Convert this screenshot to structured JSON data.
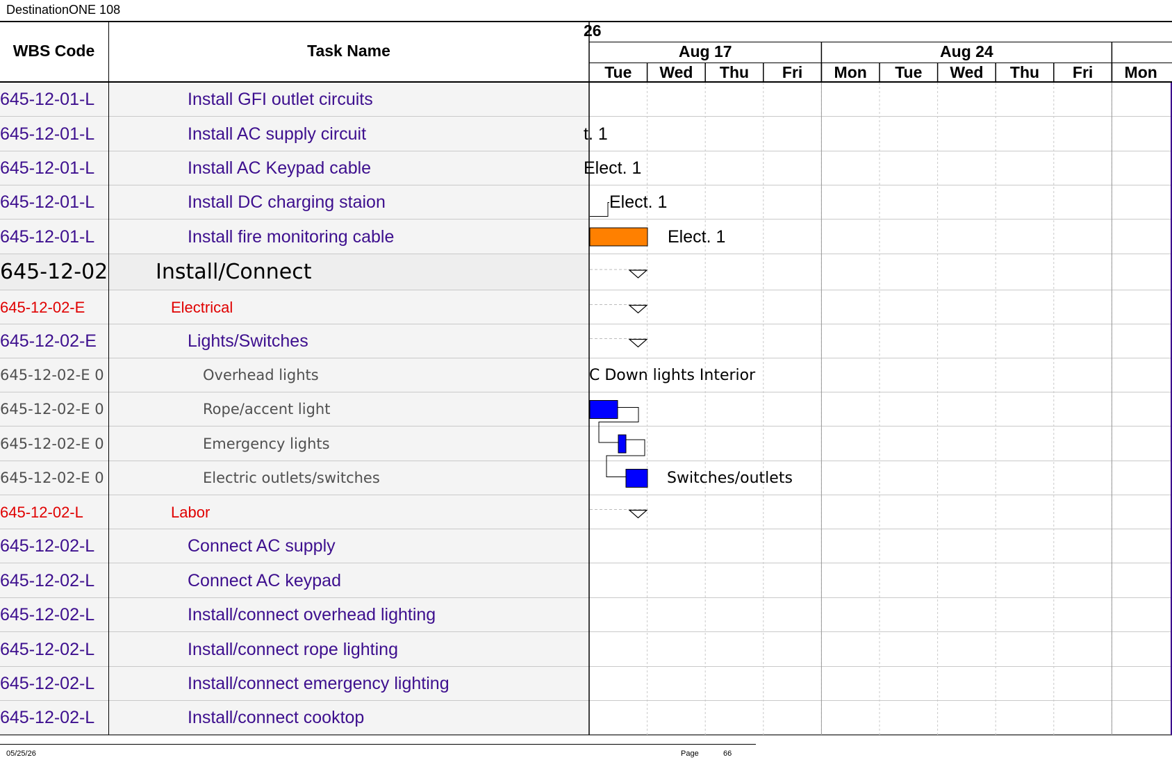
{
  "document_title": "DestinationONE 108",
  "columns": {
    "wbs_header": "WBS Code",
    "task_header": "Task Name"
  },
  "timescale": {
    "year_fragment": "26",
    "weeks": [
      "Aug 17",
      "Aug 24"
    ],
    "days": [
      "Tue",
      "Wed",
      "Thu",
      "Fri",
      "Mon",
      "Tue",
      "Wed",
      "Thu",
      "Fri",
      "Mon"
    ]
  },
  "rows": [
    {
      "wbs": "645-12-01-L",
      "task": "Install GFI outlet circuits",
      "level": "std",
      "gantt_label": ""
    },
    {
      "wbs": "645-12-01-L",
      "task": "Install AC supply circuit",
      "level": "std",
      "gantt_label": "t. 1"
    },
    {
      "wbs": "645-12-01-L",
      "task": "Install AC Keypad cable",
      "level": "std",
      "gantt_label": "Elect. 1"
    },
    {
      "wbs": "645-12-01-L",
      "task": "Install DC charging staion",
      "level": "std",
      "gantt_label": "Elect. 1"
    },
    {
      "wbs": "645-12-01-L",
      "task": "Install fire monitoring cable",
      "level": "std",
      "gantt_label": "Elect. 1"
    },
    {
      "wbs": "645-12-02",
      "task": "Install/Connect",
      "level": "big",
      "gantt_label": ""
    },
    {
      "wbs": "645-12-02-E",
      "task": "Electrical",
      "level": "red",
      "gantt_label": ""
    },
    {
      "wbs": "645-12-02-E",
      "task": "Lights/Switches",
      "level": "std",
      "gantt_label": ""
    },
    {
      "wbs": "645-12-02-E 0",
      "task": "Overhead lights",
      "level": "sub",
      "gantt_label": "C Down lights Interior"
    },
    {
      "wbs": "645-12-02-E 0",
      "task": "Rope/accent light",
      "level": "sub",
      "gantt_label": ""
    },
    {
      "wbs": "645-12-02-E 0",
      "task": "Emergency lights",
      "level": "sub",
      "gantt_label": ""
    },
    {
      "wbs": "645-12-02-E 0",
      "task": "Electric outlets/switches",
      "level": "sub",
      "gantt_label": "Switches/outlets"
    },
    {
      "wbs": "645-12-02-L",
      "task": "Labor",
      "level": "red",
      "gantt_label": ""
    },
    {
      "wbs": "645-12-02-L",
      "task": "Connect AC supply",
      "level": "std",
      "gantt_label": ""
    },
    {
      "wbs": "645-12-02-L",
      "task": "Connect AC keypad",
      "level": "std",
      "gantt_label": ""
    },
    {
      "wbs": "645-12-02-L",
      "task": "Install/connect overhead lighting",
      "level": "std",
      "gantt_label": ""
    },
    {
      "wbs": "645-12-02-L",
      "task": "Install/connect rope lighting",
      "level": "std",
      "gantt_label": ""
    },
    {
      "wbs": "645-12-02-L",
      "task": "Install/connect emergency lighting",
      "level": "std",
      "gantt_label": ""
    },
    {
      "wbs": "645-12-02-L",
      "task": "Install/connect cooktop",
      "level": "std",
      "gantt_label": ""
    }
  ],
  "colors": {
    "task_text": "#3d0f8e",
    "summary_red": "#e00000",
    "bar_orange": "#ff8000",
    "bar_blue": "#0000ff",
    "grid": "#c9c9c9"
  },
  "footer": {
    "date": "05/25/26",
    "page_label": "Page",
    "page_number": "66"
  }
}
